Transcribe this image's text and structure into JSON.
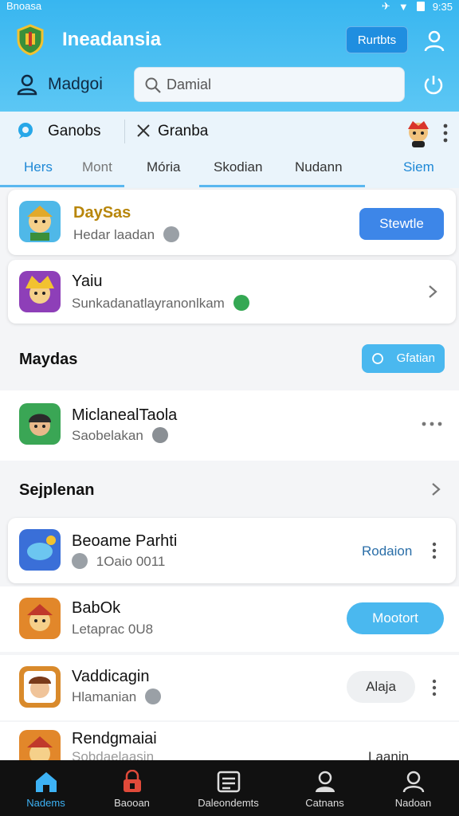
{
  "status_bar": {
    "carrier": "Bnoasa",
    "time": "9:35"
  },
  "header": {
    "app_title": "Ineadansia",
    "header_button": "Rurtbts",
    "user_name": "Madgoi",
    "search_value": "Damial"
  },
  "filters": {
    "chip1": "Ganobs",
    "chip2": "Granba"
  },
  "tabs": [
    "Hers",
    "Mont",
    "Mória",
    "Skodian",
    "Nudann",
    "Siem"
  ],
  "featured": [
    {
      "title": "DaySas",
      "subtitle": "Hedar laadan",
      "button": "Stewtle",
      "title_color": "#b8860b"
    },
    {
      "title": "Yaiu",
      "subtitle": "Sunkadanatlayranonlkam"
    }
  ],
  "section1": {
    "title": "Maydas",
    "button": "Gfatian"
  },
  "row1": {
    "title": "MiclanealTaola",
    "subtitle": "Saobelakan"
  },
  "section2": {
    "title": "Sejplenan"
  },
  "list": [
    {
      "title": "Beoame Parhti",
      "subtitle": "1Oaio 0011",
      "action": "Rodaion"
    },
    {
      "title": "BabOk",
      "subtitle": "Letaprac 0U8",
      "action": "Mootort"
    },
    {
      "title": "Vaddicagin",
      "subtitle": "Hlamanian",
      "action": "Alaja"
    },
    {
      "title": "Rendgmaiai",
      "subtitle": "Sobdaelaasin",
      "action": "Laanin"
    }
  ],
  "bottom_nav": [
    "Nadems",
    "Baooan",
    "Daleondemts",
    "Catnans",
    "Nadoan"
  ],
  "colors": {
    "accent": "#38b6f0",
    "button_blue": "#3d86e8",
    "nav_bg": "#111111",
    "active_nav": "#3db2f5"
  }
}
